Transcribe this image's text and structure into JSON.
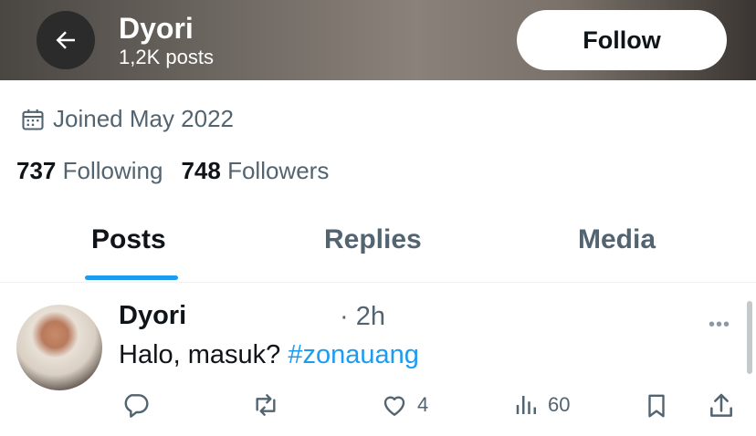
{
  "header": {
    "name": "Dyori",
    "post_count": "1,2K posts",
    "follow_label": "Follow"
  },
  "profile": {
    "joined": "Joined May 2022",
    "following_count": "737",
    "following_label": "Following",
    "followers_count": "748",
    "followers_label": "Followers"
  },
  "tabs": [
    {
      "label": "Posts",
      "active": true
    },
    {
      "label": "Replies",
      "active": false
    },
    {
      "label": "Media",
      "active": false
    }
  ],
  "post": {
    "author": "Dyori",
    "handle_time": "· 2h",
    "text": "Halo, masuk? ",
    "hashtag": "#zonauang",
    "likes": "4",
    "views": "60"
  },
  "colors": {
    "accent": "#1d9bf0",
    "muted_text": "#536471",
    "primary_text": "#0f1419"
  }
}
